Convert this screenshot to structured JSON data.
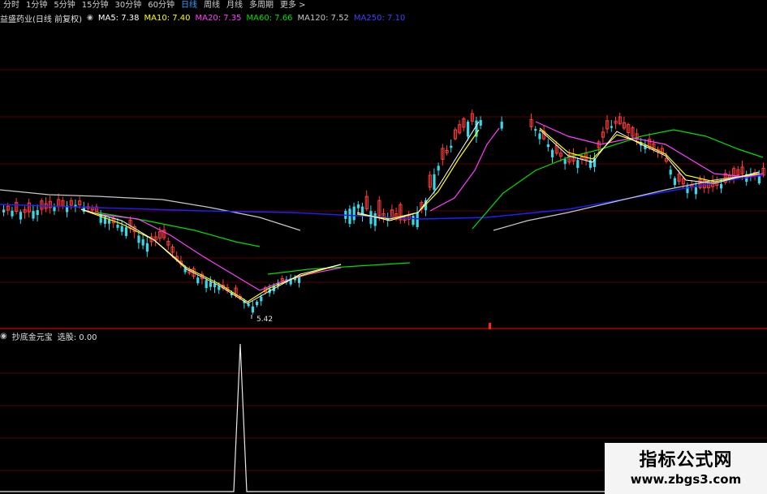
{
  "toolbar": {
    "items": [
      "分时",
      "1分钟",
      "5分钟",
      "15分钟",
      "30分钟",
      "60分钟",
      "日线",
      "周线",
      "月线",
      "多周期",
      "更多 >"
    ],
    "active_index": 6
  },
  "info": {
    "stock": "益盛药业(日线 前复权)",
    "ma": [
      {
        "label": "MA5: 7.38",
        "color": "#ffffff"
      },
      {
        "label": "MA10: 7.40",
        "color": "#ffff00"
      },
      {
        "label": "MA20: 7.35",
        "color": "#ff40ff"
      },
      {
        "label": "MA60: 7.66",
        "color": "#00e000"
      },
      {
        "label": "MA120: 7.52",
        "color": "#c8c8c8"
      },
      {
        "label": "MA250: 7.10",
        "color": "#2020ff"
      }
    ]
  },
  "price_low_label": "5.42",
  "indicator": {
    "name": "抄底金元宝",
    "value_label": "选股: 0.00"
  },
  "watermark": {
    "title": "指标公式网",
    "url": "www.zbgs3.com"
  },
  "colors": {
    "up": "#ff3b3b",
    "down": "#38d8e8",
    "grid": "#5a0000",
    "separator": "#b00000",
    "ma5": "#ffffff",
    "ma10": "#ffff00",
    "ma20": "#ff40ff",
    "ma60": "#00e000",
    "ma120": "#c8c8c8",
    "ma250": "#2020ff"
  }
}
